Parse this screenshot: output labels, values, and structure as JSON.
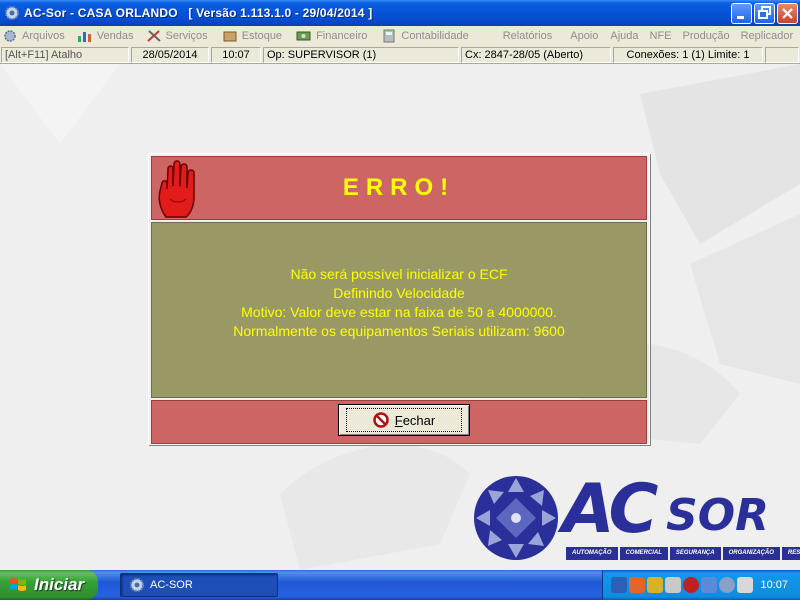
{
  "window": {
    "title": "AC-Sor - CASA ORLANDO   [ Versão 1.113.1.0 - 29/04/2014 ]"
  },
  "menu": {
    "items": [
      {
        "label": "Arquivos",
        "icon": "gear-icon"
      },
      {
        "label": "Vendas",
        "icon": "chart-icon"
      },
      {
        "label": "Serviços",
        "icon": "tools-icon"
      },
      {
        "label": "Estoque",
        "icon": "box-icon"
      },
      {
        "label": "Financeiro",
        "icon": "money-icon"
      },
      {
        "label": "Contabilidade",
        "icon": "calculator-icon"
      },
      {
        "label": "Relatórios"
      },
      {
        "label": "Apoio"
      },
      {
        "label": "Ajuda"
      },
      {
        "label": "NFE"
      },
      {
        "label": "Produção"
      },
      {
        "label": "Replicador"
      }
    ]
  },
  "status": {
    "shortcut": "[Alt+F11] Atalho",
    "date": "28/05/2014",
    "time": "10:07",
    "operator": "Op: SUPERVISOR (1)",
    "cash": "Cx: 2847-28/05 (Aberto)",
    "connections": "Conexões: 1 (1)  Limite: 1"
  },
  "dialog": {
    "title": "ERRO!",
    "lines": [
      "Não será possível inicializar o ECF",
      "Definindo Velocidade",
      "Motivo: Valor deve estar na faixa de 50 a 4000000.",
      "Normalmente os equipamentos Seriais utilizam: 9600"
    ],
    "button": {
      "accel": "F",
      "rest": "echar"
    },
    "colors": {
      "header": "#cd6565",
      "body": "#999966",
      "text": "#ffff00"
    }
  },
  "logo": {
    "ac": "AC",
    "sor": "SOR",
    "tagline": [
      "AUTOMAÇÃO",
      "COMERCIAL",
      "SEGURANÇA",
      "ORGANIZAÇÃO",
      "RESULTADOS"
    ]
  },
  "taskbar": {
    "start": "Iniciar",
    "task": "AC-SOR",
    "clock": "10:07"
  }
}
